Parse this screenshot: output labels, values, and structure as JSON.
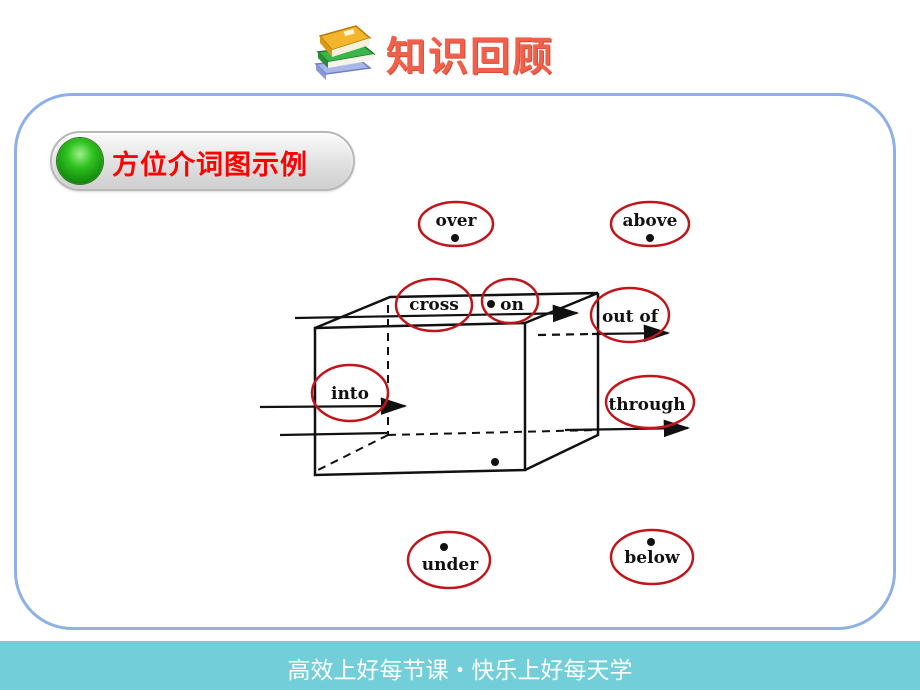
{
  "header": {
    "title": "知识回顾",
    "icon": "books-stack-icon"
  },
  "section": {
    "title": "方位介词图示例",
    "icon": "green-ball-icon"
  },
  "diagram": {
    "labels": {
      "over": "over",
      "above": "above",
      "cross": "cross",
      "on": "on",
      "out_of": "out of",
      "into": "into",
      "through": "through",
      "under": "under",
      "below": "below"
    },
    "highlight_color": "#c0151b"
  },
  "footer": {
    "text": "高效上好每节课・快乐上好每天学"
  }
}
